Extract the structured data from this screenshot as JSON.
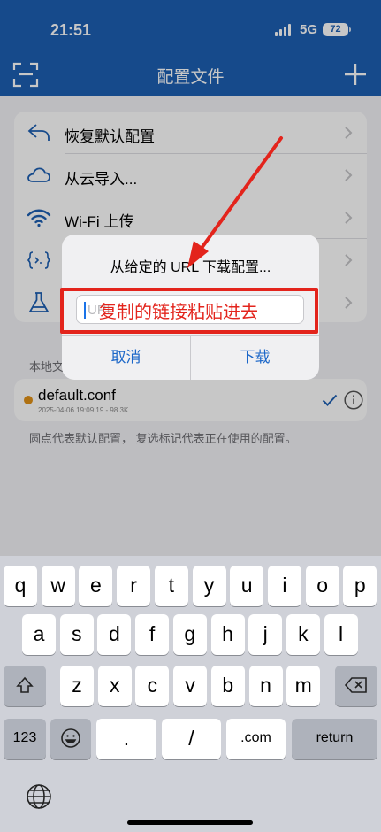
{
  "status": {
    "time": "21:51",
    "network": "5G",
    "battery": "72"
  },
  "nav": {
    "title": "配置文件",
    "left_icon": "scan-icon",
    "right_icon": "add-icon"
  },
  "menu": [
    {
      "label": "恢复默认配置",
      "icon": "restore-icon"
    },
    {
      "label": "从云导入...",
      "icon": "cloud-icon"
    },
    {
      "label": "Wi-Fi 上传",
      "icon": "wifi-icon"
    },
    {
      "label": "",
      "icon": "code-icon"
    },
    {
      "label": "",
      "icon": "flask-icon"
    }
  ],
  "local": {
    "header": "本地文",
    "file_name": "default.conf",
    "file_meta": "2025-04-06 19:09:19 - 98.3K",
    "footnote": "圆点代表默认配置， 复选标记代表正在使用的配置。"
  },
  "dialog": {
    "title": "从给定的 URL 下载配置...",
    "input_placeholder": "URL",
    "cancel_label": "取消",
    "download_label": "下载"
  },
  "annotation": {
    "text": "复制的链接粘贴进去",
    "color": "#e3241c"
  },
  "keyboard": {
    "row1": [
      "q",
      "w",
      "e",
      "r",
      "t",
      "y",
      "u",
      "i",
      "o",
      "p"
    ],
    "row2": [
      "a",
      "s",
      "d",
      "f",
      "g",
      "h",
      "j",
      "k",
      "l"
    ],
    "row3": [
      "z",
      "x",
      "c",
      "v",
      "b",
      "n",
      "m"
    ],
    "numbers_label": "123",
    "period_label": ".",
    "slash_label": "/",
    "dotcom_label": ".com",
    "return_label": "return"
  },
  "colors": {
    "nav_bar": "#1d5fb3",
    "accent": "#1a66c8",
    "default_dot": "#e19118"
  }
}
